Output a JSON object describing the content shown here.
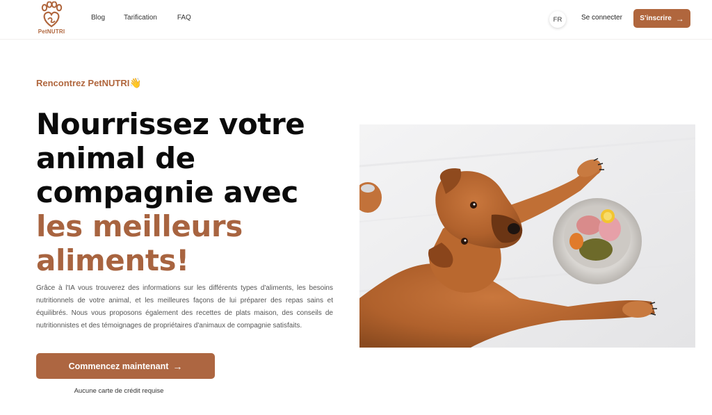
{
  "brand": {
    "name": "PetNUTRI",
    "color": "#b0663d"
  },
  "nav": {
    "items": [
      {
        "label": "Blog"
      },
      {
        "label": "Tarification"
      },
      {
        "label": "FAQ"
      }
    ]
  },
  "header": {
    "language": "FR",
    "login_label": "Se connecter",
    "signup_label": "S’inscrire",
    "signup_icon": "arrow-right-icon"
  },
  "hero": {
    "eyebrow": "Rencontrez PetNUTRI",
    "eyebrow_emoji": "👋",
    "headline_lines": [
      "Nourrissez votre",
      "animal de",
      "compagnie avec"
    ],
    "headline_accent_lines": [
      "les meilleurs",
      "aliments!"
    ],
    "description": "Grâce à l'IA vous trouverez des informations sur les différents types d'aliments, les besoins nutritionnels de votre animal, et les meilleures façons de lui préparer des repas sains et équilibrés. Nous vous proposons également des recettes de plats maison, des conseils de nutritionnistes et des témoignages de propriétaires d'animaux de compagnie satisfaits.",
    "cta_label": "Commencez maintenant",
    "cta_icon": "arrow-right-icon",
    "note": "Aucune carte de crédit requise",
    "image_subject": "dog-with-food-bowl",
    "accent_color": "#ad6641"
  }
}
